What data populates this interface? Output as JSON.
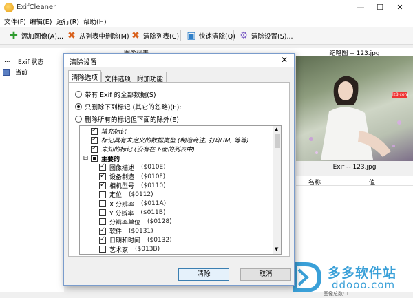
{
  "window": {
    "title": "ExifCleaner",
    "controls": [
      "—",
      "☐",
      "✕"
    ]
  },
  "menu": [
    "文件(F)",
    "编辑(E)",
    "运行(R)",
    "帮助(H)"
  ],
  "toolbar": {
    "add_images": "添加图像(A)...",
    "remove_from_list": "从列表中删除(M)",
    "clear_list": "清除列表(C)",
    "quick_clean": "快速清除(Q)",
    "clean_settings": "清除设置(S)..."
  },
  "image_list": {
    "title": "图像列表",
    "columns": [
      "...",
      "Exif 状态"
    ],
    "rows": [
      {
        "status": "当前"
      }
    ]
  },
  "thumbnail": {
    "title": "缩略图 -- 123.jpg",
    "badge": "lz8.com"
  },
  "exif_panel": {
    "title": "Exif -- 123.jpg",
    "columns": [
      "名称",
      "值"
    ]
  },
  "status_bar": {
    "text": "图像总数: 1"
  },
  "watermark": {
    "line1": "多多软件站",
    "line2": "ddooo.com"
  },
  "dialog": {
    "title": "清除设置",
    "tabs": [
      "清除选项",
      "文件选项",
      "附加功能"
    ],
    "active_tab": 0,
    "options": [
      {
        "label": "带有 Exif 的全部数据(S)",
        "checked": false
      },
      {
        "label": "只删除下列标记 (其它的忽略)(F):",
        "checked": true
      },
      {
        "label": "删除所有的标记但下面的除外(E):",
        "checked": false
      }
    ],
    "tree": [
      {
        "label": "填充标记",
        "code": "",
        "checked": true,
        "italic": true,
        "level": 1
      },
      {
        "label": "标记具有未定义的数据类型 (制造商注, 打印 IM, 等等)",
        "code": "",
        "checked": true,
        "italic": true,
        "level": 1
      },
      {
        "label": "未知的标记 (没有在下面的列表中)",
        "code": "",
        "checked": true,
        "italic": true,
        "level": 1
      },
      {
        "label": "主要的",
        "code": "",
        "checked": "partial",
        "italic": false,
        "level": 0,
        "bold": true
      },
      {
        "label": "图像描述",
        "code": "($010E)",
        "checked": true,
        "level": 2
      },
      {
        "label": "设备制造",
        "code": "($010F)",
        "checked": true,
        "level": 2
      },
      {
        "label": "相机型号",
        "code": "($0110)",
        "checked": true,
        "level": 2
      },
      {
        "label": "定位",
        "code": "($0112)",
        "checked": false,
        "level": 2
      },
      {
        "label": "X 分辨率",
        "code": "($011A)",
        "checked": false,
        "level": 2
      },
      {
        "label": "Y 分辨率",
        "code": "($011B)",
        "checked": false,
        "level": 2
      },
      {
        "label": "分辨率单位",
        "code": "($0128)",
        "checked": false,
        "level": 2
      },
      {
        "label": "软件",
        "code": "($0131)",
        "checked": true,
        "level": 2
      },
      {
        "label": "日期和时间",
        "code": "($0132)",
        "checked": true,
        "level": 2
      },
      {
        "label": "艺术家",
        "code": "($013B)",
        "checked": false,
        "level": 2
      }
    ],
    "buttons": {
      "ok": "清除",
      "cancel": "取消"
    }
  },
  "colors": {
    "accent": "#3c7fb1",
    "watermark": "#3aa0d8"
  }
}
